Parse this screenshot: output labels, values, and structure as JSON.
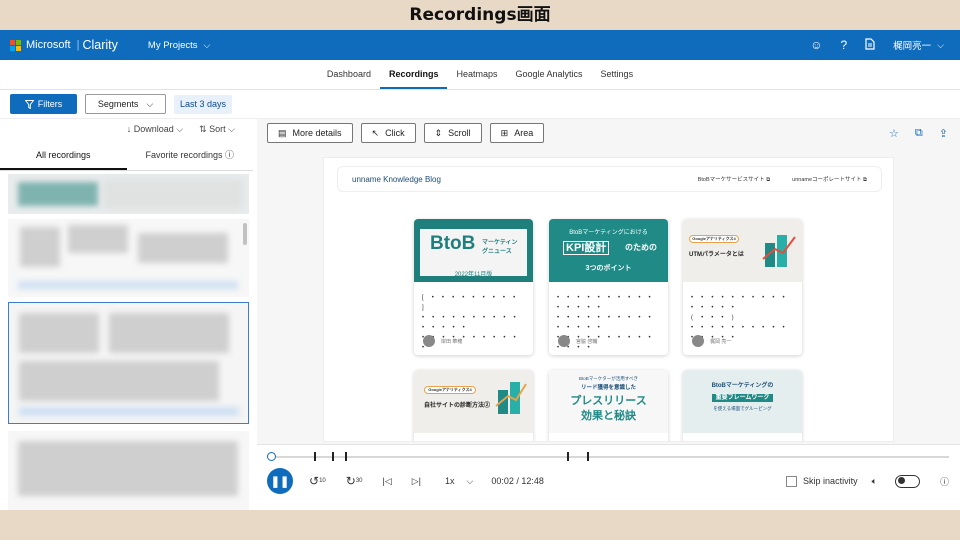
{
  "slide_title": "Recordings画面",
  "topbar": {
    "brand": "Microsoft",
    "product": "Clarity",
    "project_menu": "My Projects",
    "user_name": "梶岡亮一",
    "icons": [
      "smiley-icon",
      "help-icon",
      "document-icon"
    ],
    "colors": {
      "bar": "#0f6cbd"
    }
  },
  "nav": {
    "tabs": [
      {
        "label": "Dashboard"
      },
      {
        "label": "Recordings"
      },
      {
        "label": "Heatmaps"
      },
      {
        "label": "Google Analytics"
      },
      {
        "label": "Settings"
      }
    ],
    "active": "Recordings"
  },
  "filterbar": {
    "filters_label": "Filters",
    "segments_label": "Segments",
    "date_chip": "Last 3 days"
  },
  "list": {
    "download_label": "Download",
    "sort_label": "Sort",
    "tabs": [
      {
        "label": "All recordings"
      },
      {
        "label": "Favorite recordings"
      }
    ]
  },
  "viewer_tools": {
    "more_details": "More details",
    "click": "Click",
    "scroll": "Scroll",
    "area": "Area"
  },
  "blog": {
    "name": "unname Knowledge Blog",
    "link1": "BtoBマーケサービスサイト",
    "link2": "unnameコーポレートサイト",
    "cards": [
      {
        "title": "BtoB",
        "sub": "マーケティングニュース",
        "tag": "2022年11月版",
        "dots1": "[ • • • • • • • • • ]",
        "dots2": "• • • • • • • • • • • • • • •",
        "dots3": "• • • • • • • • • • •",
        "author": "岸田 華穂"
      },
      {
        "title": "KPI設計",
        "pre": "BtoBマーケティングにおける",
        "post": "のための",
        "tag": "3つのポイント",
        "dots1": "• • • • • • • • • • • • • • •",
        "dots2": "• • • • • • • • • • • • • • •",
        "dots3": "• • • • • • • • • • • • • •",
        "author": "宮脇 啓輔"
      },
      {
        "title": "UTMパラメータとは",
        "badge": "Googleアナリティクス4",
        "dots1": "• • • • • • • • • • • • • • •",
        "dots2": "( • • • )",
        "dots3": "• • • • • • • • • • • • • • •",
        "author": "梶岡 亮一"
      },
      {
        "title": "自社サイトの診断方法②",
        "badge": "Googleアナリティクス4"
      },
      {
        "title": "プレスリリース",
        "pre": "BtoBマーケターが活用すべき",
        "sub1": "リード獲得を意識した",
        "sub2": "効果と秘訣"
      },
      {
        "title": "重要フレームワーク",
        "pre": "BtoBマーケティングの",
        "post": "を使える場面でグルーピング"
      }
    ]
  },
  "player": {
    "speed": "1x",
    "time": "00:02 / 12:48",
    "skip_label": "Skip inactivity",
    "rewind": "10",
    "forward": "30",
    "progress": 0.003
  }
}
